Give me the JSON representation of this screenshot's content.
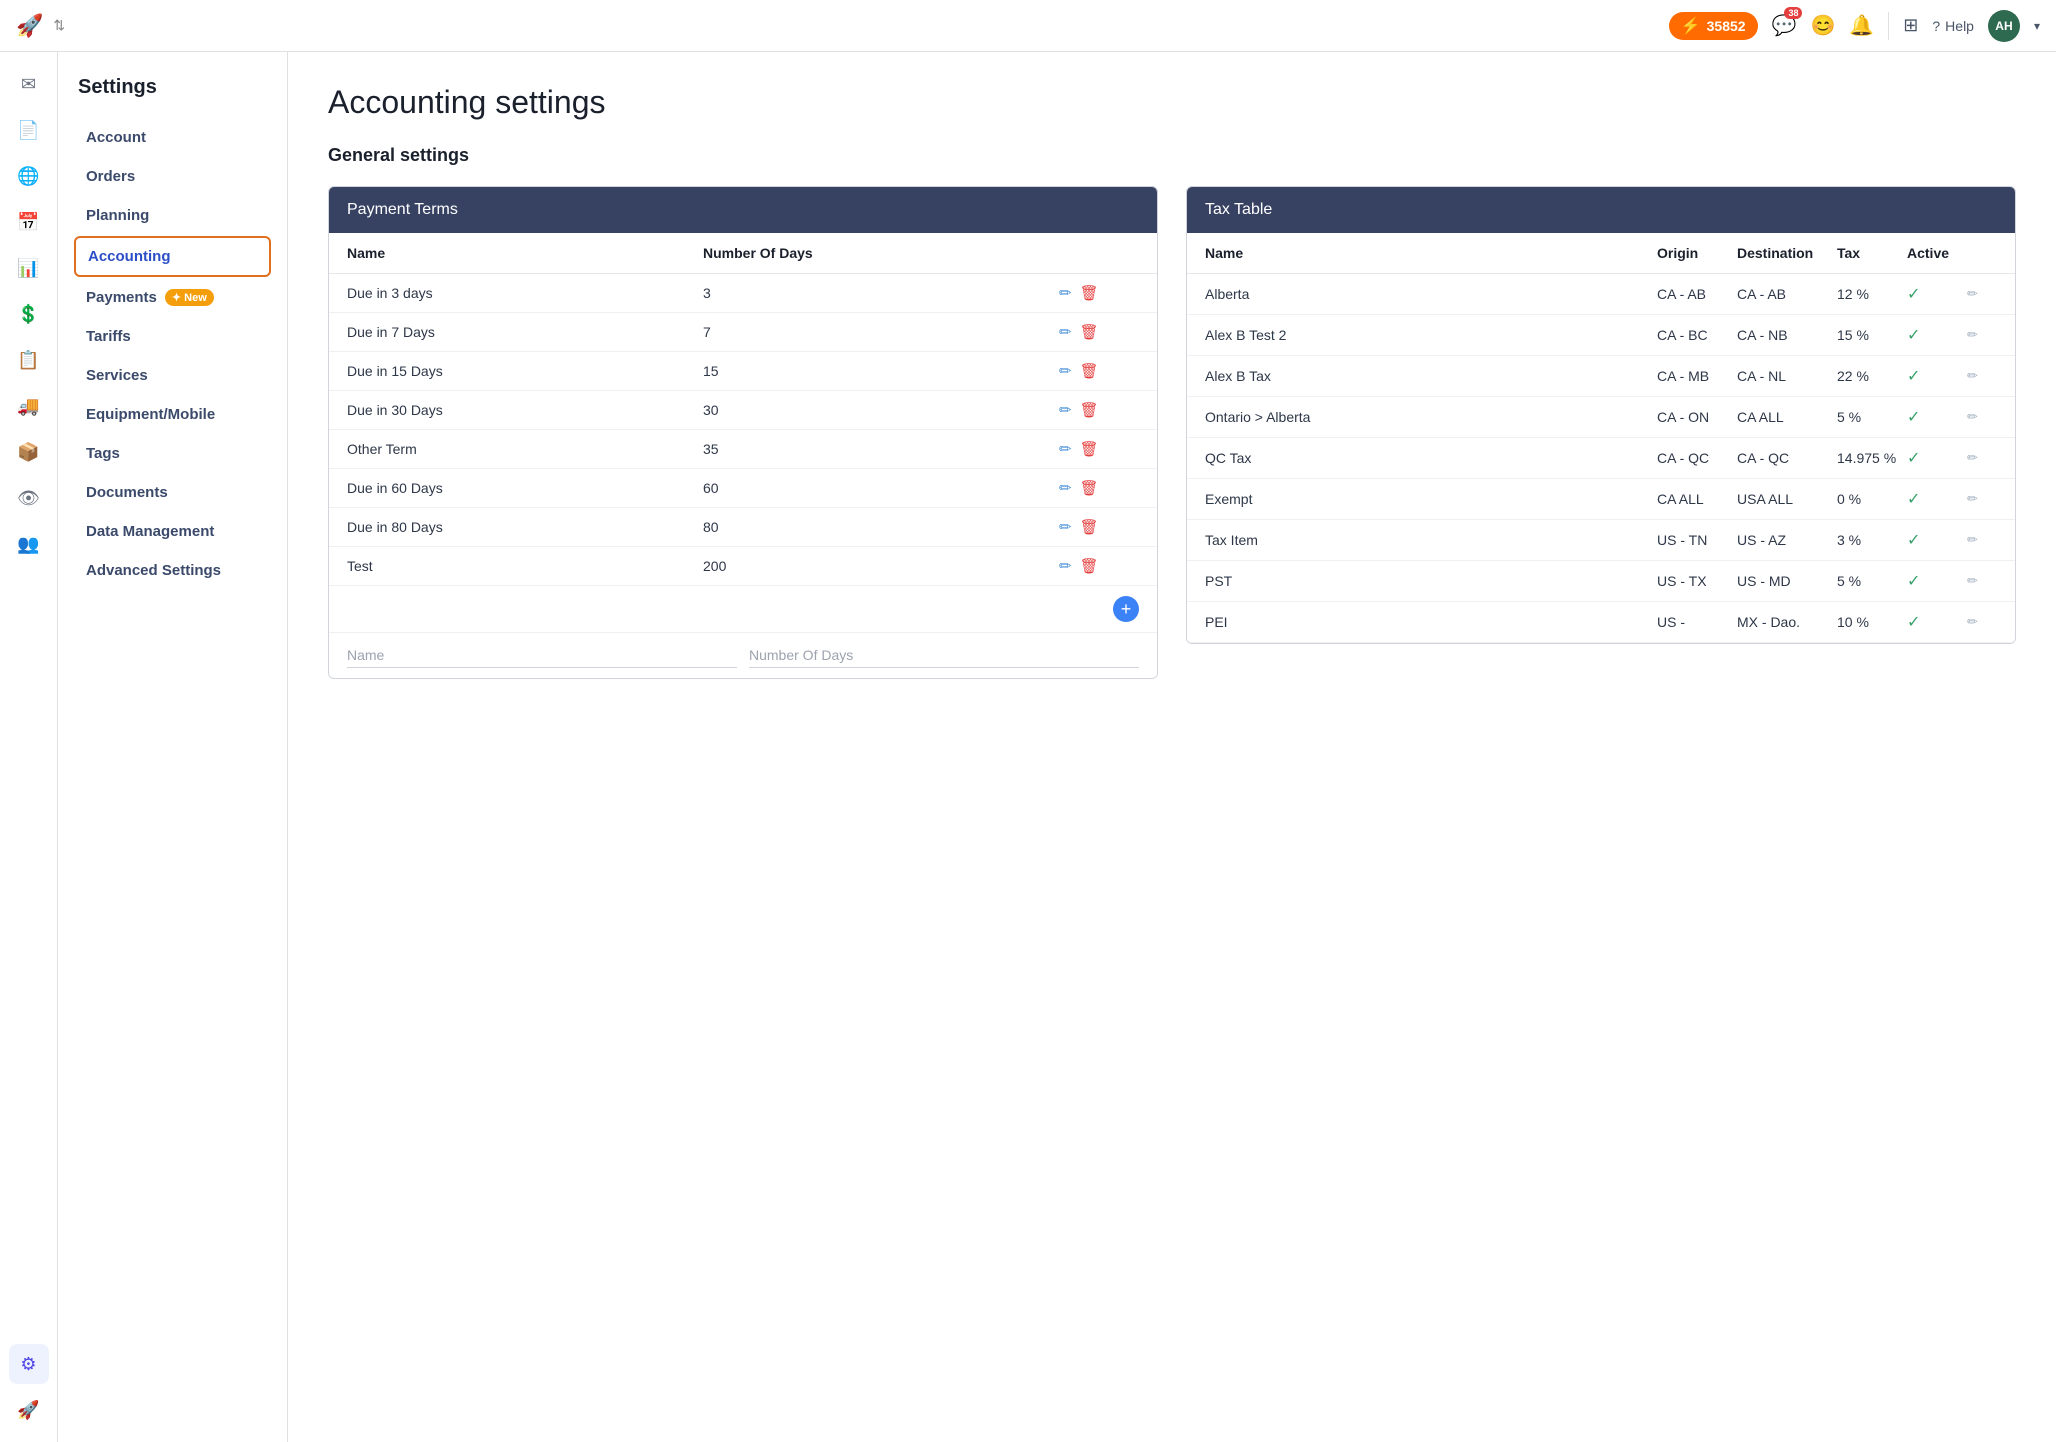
{
  "topbar": {
    "score": "35852",
    "notifications_count": "38",
    "help_label": "Help",
    "avatar_initials": "AH"
  },
  "sidebar": {
    "title": "Settings",
    "items": [
      {
        "id": "account",
        "label": "Account",
        "active": false
      },
      {
        "id": "orders",
        "label": "Orders",
        "active": false
      },
      {
        "id": "planning",
        "label": "Planning",
        "active": false
      },
      {
        "id": "accounting",
        "label": "Accounting",
        "active": true
      },
      {
        "id": "payments",
        "label": "Payments",
        "active": false,
        "badge": "New"
      },
      {
        "id": "tariffs",
        "label": "Tariffs",
        "active": false
      },
      {
        "id": "services",
        "label": "Services",
        "active": false
      },
      {
        "id": "equipment",
        "label": "Equipment/Mobile",
        "active": false
      },
      {
        "id": "tags",
        "label": "Tags",
        "active": false
      },
      {
        "id": "documents",
        "label": "Documents",
        "active": false
      },
      {
        "id": "data-management",
        "label": "Data Management",
        "active": false
      },
      {
        "id": "advanced",
        "label": "Advanced Settings",
        "active": false
      }
    ]
  },
  "content": {
    "page_title": "Accounting settings",
    "section_title": "General settings",
    "payment_terms": {
      "header": "Payment Terms",
      "columns": [
        "Name",
        "Number Of Days",
        ""
      ],
      "rows": [
        {
          "name": "Due in 3 days",
          "days": "3"
        },
        {
          "name": "Due in 7 Days",
          "days": "7"
        },
        {
          "name": "Due in 15 Days",
          "days": "15"
        },
        {
          "name": "Due in 30 Days",
          "days": "30"
        },
        {
          "name": "Other Term",
          "days": "35"
        },
        {
          "name": "Due in 60 Days",
          "days": "60"
        },
        {
          "name": "Due in 80 Days",
          "days": "80"
        },
        {
          "name": "Test",
          "days": "200"
        }
      ],
      "input_name_placeholder": "Name",
      "input_days_placeholder": "Number Of Days"
    },
    "tax_table": {
      "header": "Tax Table",
      "columns": [
        "Name",
        "Origin",
        "Destination",
        "Tax",
        "Active",
        ""
      ],
      "rows": [
        {
          "name": "Alberta",
          "origin": "CA - AB",
          "destination": "CA - AB",
          "tax": "12 %",
          "active": true
        },
        {
          "name": "Alex B Test 2",
          "origin": "CA - BC",
          "destination": "CA - NB",
          "tax": "15 %",
          "active": true
        },
        {
          "name": "Alex B Tax",
          "origin": "CA - MB",
          "destination": "CA - NL",
          "tax": "22 %",
          "active": true
        },
        {
          "name": "Ontario > Alberta",
          "origin": "CA - ON",
          "destination": "CA ALL",
          "tax": "5 %",
          "active": true
        },
        {
          "name": "QC Tax",
          "origin": "CA - QC",
          "destination": "CA - QC",
          "tax": "14.975 %",
          "active": true
        },
        {
          "name": "Exempt",
          "origin": "CA ALL",
          "destination": "USA ALL",
          "tax": "0 %",
          "active": true
        },
        {
          "name": "Tax Item",
          "origin": "US - TN",
          "destination": "US - AZ",
          "tax": "3 %",
          "active": true
        },
        {
          "name": "PST",
          "origin": "US - TX",
          "destination": "US - MD",
          "tax": "5 %",
          "active": true
        },
        {
          "name": "PEI",
          "origin": "US -",
          "destination": "MX - Dao.",
          "tax": "10 %",
          "active": true
        }
      ]
    }
  },
  "rail_icons": [
    {
      "id": "mail",
      "symbol": "✉",
      "active": false
    },
    {
      "id": "document",
      "symbol": "☰",
      "active": false
    },
    {
      "id": "globe",
      "symbol": "⊕",
      "active": false
    },
    {
      "id": "calendar",
      "symbol": "▦",
      "active": false
    },
    {
      "id": "chart",
      "symbol": "↗",
      "active": false
    },
    {
      "id": "dollar",
      "symbol": "$",
      "active": false
    },
    {
      "id": "clipboard",
      "symbol": "⊞",
      "active": false
    },
    {
      "id": "truck",
      "symbol": "▣",
      "active": false
    },
    {
      "id": "box",
      "symbol": "⬡",
      "active": false
    },
    {
      "id": "people",
      "symbol": "⊙",
      "active": false
    },
    {
      "id": "team",
      "symbol": "⊗",
      "active": false
    },
    {
      "id": "gear",
      "symbol": "⚙",
      "active": true
    }
  ]
}
